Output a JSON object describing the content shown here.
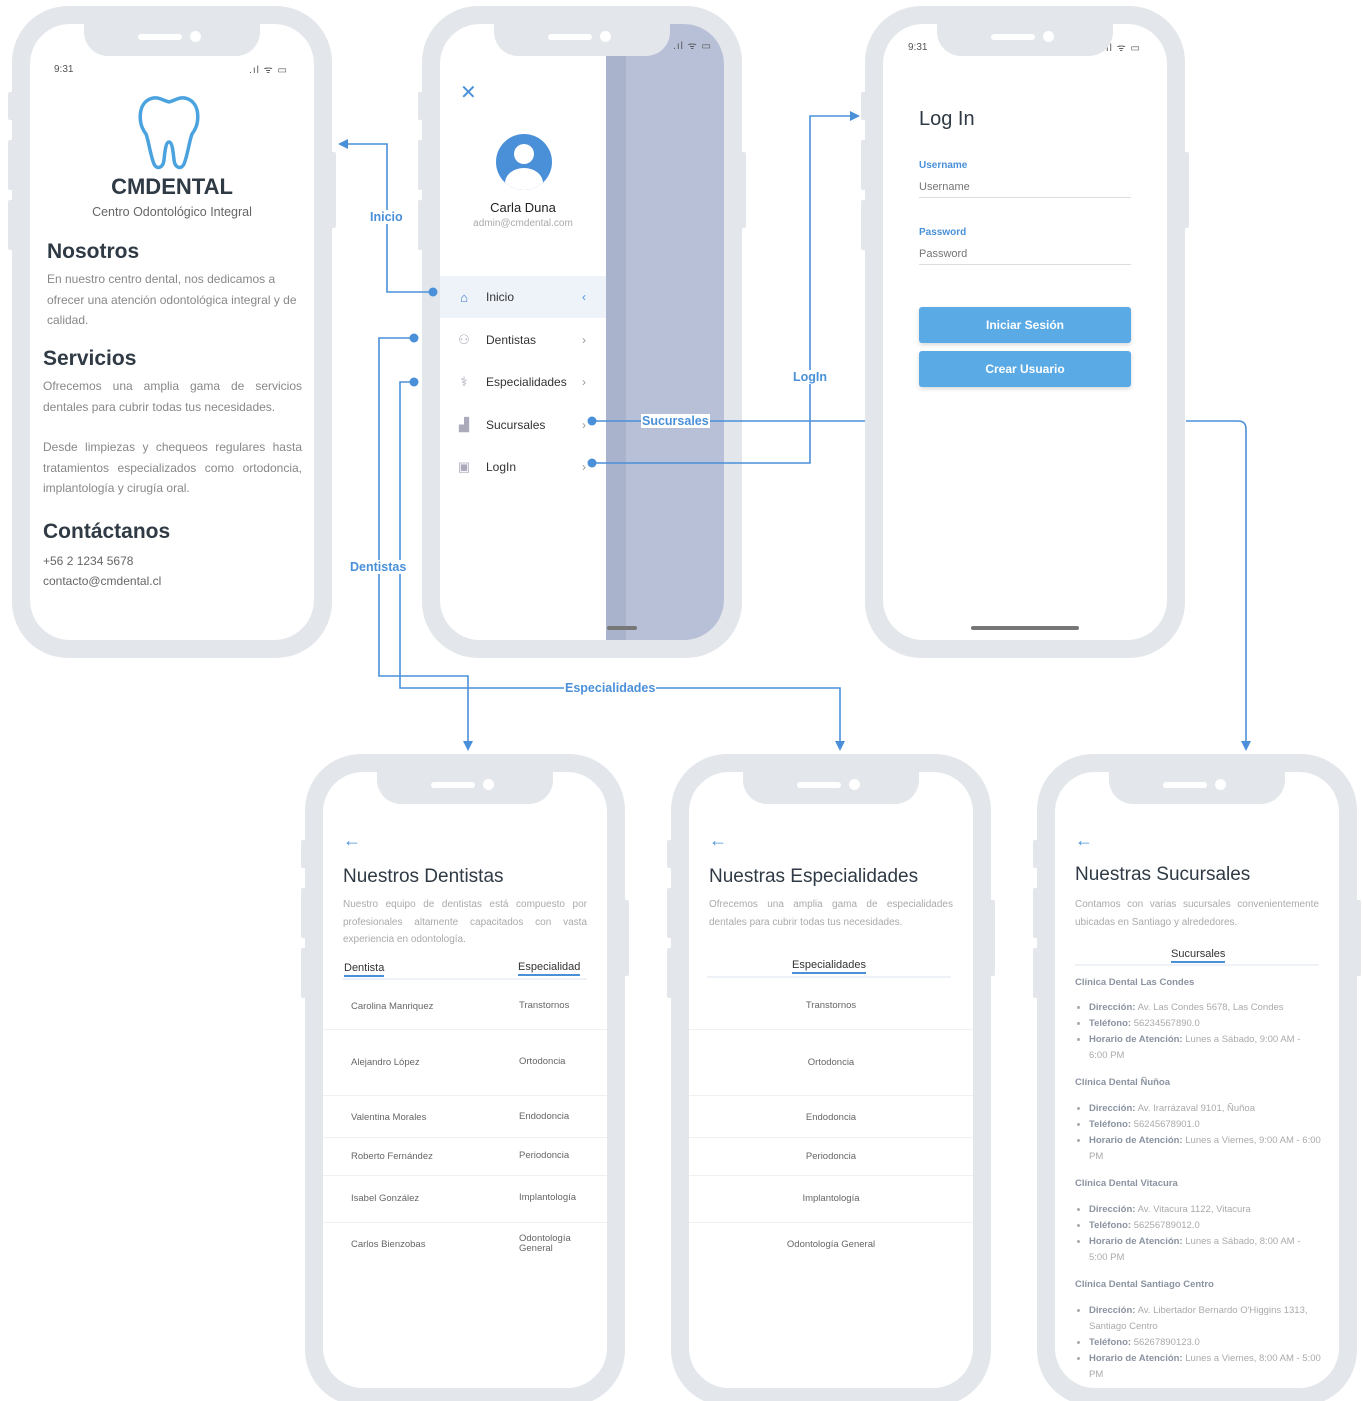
{
  "status_time": "9:31",
  "status_icons": ".ıl ᯤ ▭",
  "home": {
    "brand": "CMDENTAL",
    "brand_subtitle": "Centro Odontológico Integral",
    "about_title": "Nosotros",
    "about_text": "En nuestro centro dental, nos dedicamos a ofrecer una atención odontológica integral y de calidad.",
    "services_title": "Servicios",
    "services_text_1": "Ofrecemos una amplia gama de servicios dentales para cubrir todas tus necesidades.",
    "services_text_2": "Desde limpiezas y chequeos regulares hasta tratamientos especializados como ortodoncia, implantología y cirugía oral.",
    "contact_title": "Contáctanos",
    "contact_phone": "+56 2 1234 5678",
    "contact_email": "contacto@cmdental.cl"
  },
  "menu": {
    "user_name": "Carla Duna",
    "user_email": "admin@cmdental.com",
    "items": [
      {
        "label": "Inicio",
        "icon": "home-icon"
      },
      {
        "label": "Dentistas",
        "icon": "users-icon"
      },
      {
        "label": "Especialidades",
        "icon": "tooth-icon"
      },
      {
        "label": "Sucursales",
        "icon": "building-icon"
      },
      {
        "label": "LogIn",
        "icon": "id-card-icon"
      }
    ]
  },
  "login": {
    "title": "Log In",
    "username_label": "Username",
    "username_placeholder": "Username",
    "password_label": "Password",
    "password_placeholder": "Password",
    "signin_button": "Iniciar Sesión",
    "create_button": "Crear Usuario"
  },
  "connectors": {
    "inicio": "Inicio",
    "login": "LogIn",
    "sucursales": "Sucursales",
    "dentistas": "Dentistas",
    "especialidades": "Especialidades"
  },
  "dentists": {
    "title": "Nuestros Dentistas",
    "description": "Nuestro equipo de dentistas está compuesto por profesionales altamente capacitados con vasta experiencia en odontología.",
    "col_dentist": "Dentista",
    "col_specialty": "Especialidad",
    "rows": [
      {
        "name": "Carolina Manriquez",
        "specialty": "Transtornos"
      },
      {
        "name": "Alejandro López",
        "specialty": "Ortodoncia"
      },
      {
        "name": "Valentina Morales",
        "specialty": "Endodoncia"
      },
      {
        "name": "Roberto Fernández",
        "specialty": "Periodoncia"
      },
      {
        "name": "Isabel González",
        "specialty": "Implantología"
      },
      {
        "name": "Carlos Bienzobas",
        "specialty": "Odontología General"
      }
    ]
  },
  "specialties": {
    "title": "Nuestras Especialidades",
    "description": "Ofrecemos una amplia gama de especialidades dentales para cubrir todas tus necesidades.",
    "col_header": "Especialidades",
    "items": [
      "Transtornos",
      "Ortodoncia",
      "Endodoncia",
      "Periodoncia",
      "Implantología",
      "Odontología General"
    ]
  },
  "branches": {
    "title": "Nuestras Sucursales",
    "description": "Contamos con varias sucursales convenientemente ubicadas en Santiago y alrededores.",
    "col_header": "Sucursales",
    "address_label": "Dirección:",
    "phone_label": "Teléfono:",
    "hours_label": "Horario de Atención:",
    "items": [
      {
        "name": "Clínica Dental Las Condes",
        "address": "Av. Las Condes 5678, Las Condes",
        "phone": "56234567890.0",
        "hours": "Lunes a Sábado, 9:00 AM - 6:00 PM"
      },
      {
        "name": "Clínica Dental Ñuñoa",
        "address": "Av. Irarrázaval 9101, Ñuñoa",
        "phone": "56245678901.0",
        "hours": "Lunes a Viernes, 9:00 AM - 6:00 PM"
      },
      {
        "name": "Clínica Dental Vitacura",
        "address": "Av. Vitacura 1122, Vitacura",
        "phone": "56256789012.0",
        "hours": "Lunes a Sábado, 8:00 AM - 5:00 PM"
      },
      {
        "name": "Clínica Dental Santiago Centro",
        "address": "Av. Libertador Bernardo O'Higgins 1313, Santiago Centro",
        "phone": "56267890123.0",
        "hours": "Lunes a Viernes, 8:00 AM - 5:00 PM"
      }
    ]
  }
}
